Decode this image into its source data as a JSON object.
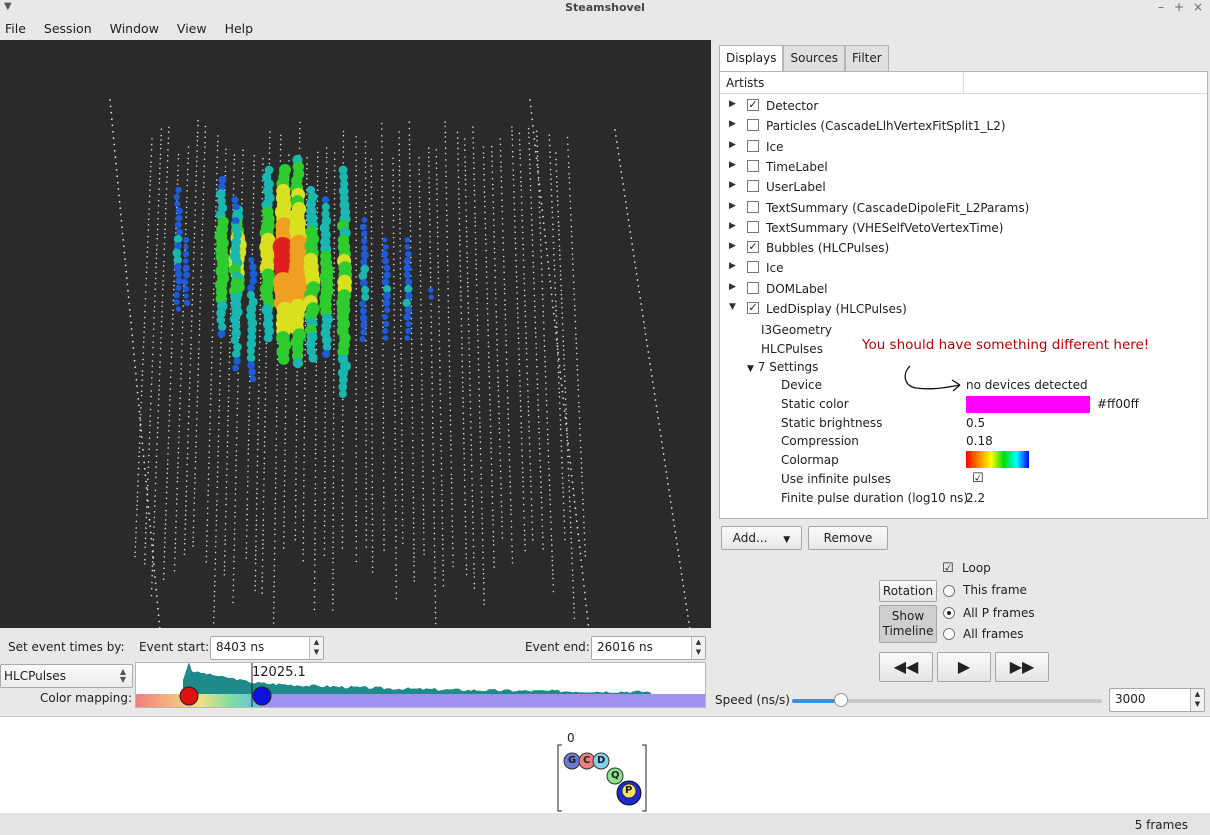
{
  "window": {
    "title": "Steamshovel"
  },
  "menu": [
    {
      "label": "File"
    },
    {
      "label": "Session"
    },
    {
      "label": "Window"
    },
    {
      "label": "View"
    },
    {
      "label": "Help"
    }
  ],
  "event_times": {
    "set_label": "Set event times by:",
    "start_label": "Event start:",
    "start_value": "8403 ns",
    "end_label": "Event end:",
    "end_value": "26016 ns"
  },
  "timeline": {
    "source": "HLCPulses",
    "color_mapping_label": "Color mapping:",
    "cursor_value": "12025.1"
  },
  "tabs": [
    {
      "label": "Displays"
    },
    {
      "label": "Sources"
    },
    {
      "label": "Filter"
    }
  ],
  "tree": {
    "header": "Artists",
    "artists": [
      {
        "label": "Detector",
        "checked": true
      },
      {
        "label": "Particles (CascadeLlhVertexFitSplit1_L2)",
        "checked": false
      },
      {
        "label": "Ice",
        "checked": false
      },
      {
        "label": "TimeLabel",
        "checked": false
      },
      {
        "label": "UserLabel",
        "checked": false
      },
      {
        "label": "TextSummary (CascadeDipoleFit_L2Params)",
        "checked": false
      },
      {
        "label": "TextSummary (VHESelfVetoVertexTime)",
        "checked": false
      },
      {
        "label": "Bubbles (HLCPulses)",
        "checked": true
      },
      {
        "label": "Ice",
        "checked": false
      },
      {
        "label": "DOMLabel",
        "checked": false
      },
      {
        "label": "LedDisplay (HLCPulses)",
        "checked": true
      }
    ],
    "inputs": [
      "I3Geometry",
      "HLCPulses"
    ],
    "settings_label": "7 Settings",
    "annotation": "You should have something different here!",
    "settings": {
      "device_label": "Device",
      "device_value": "no devices detected",
      "static_color_label": "Static color",
      "static_color_value": "#ff00ff",
      "static_brightness_label": "Static brightness",
      "static_brightness_value": "0.5",
      "compression_label": "Compression",
      "compression_value": "0.18",
      "colormap_label": "Colormap",
      "infinite_label": "Use infinite pulses",
      "finite_label": "Finite pulse duration (log10 ns)",
      "finite_value": "2.2"
    }
  },
  "buttons": {
    "add": "Add...",
    "remove": "Remove",
    "rotation": "Rotation",
    "show_timeline": "Show Timeline"
  },
  "playback": {
    "loop_label": "Loop",
    "this_frame": "This frame",
    "all_p_frames": "All P frames",
    "all_frames": "All frames",
    "speed_label": "Speed (ns/s)",
    "speed_value": "3000"
  },
  "frames": {
    "index": "0",
    "letters": [
      "G",
      "C",
      "D",
      "Q",
      "P"
    ],
    "count_label": "5 frames"
  },
  "colors": {
    "static_color": "#ff00ff",
    "accent": "#3c8ddc",
    "annotation": "#c00000"
  }
}
